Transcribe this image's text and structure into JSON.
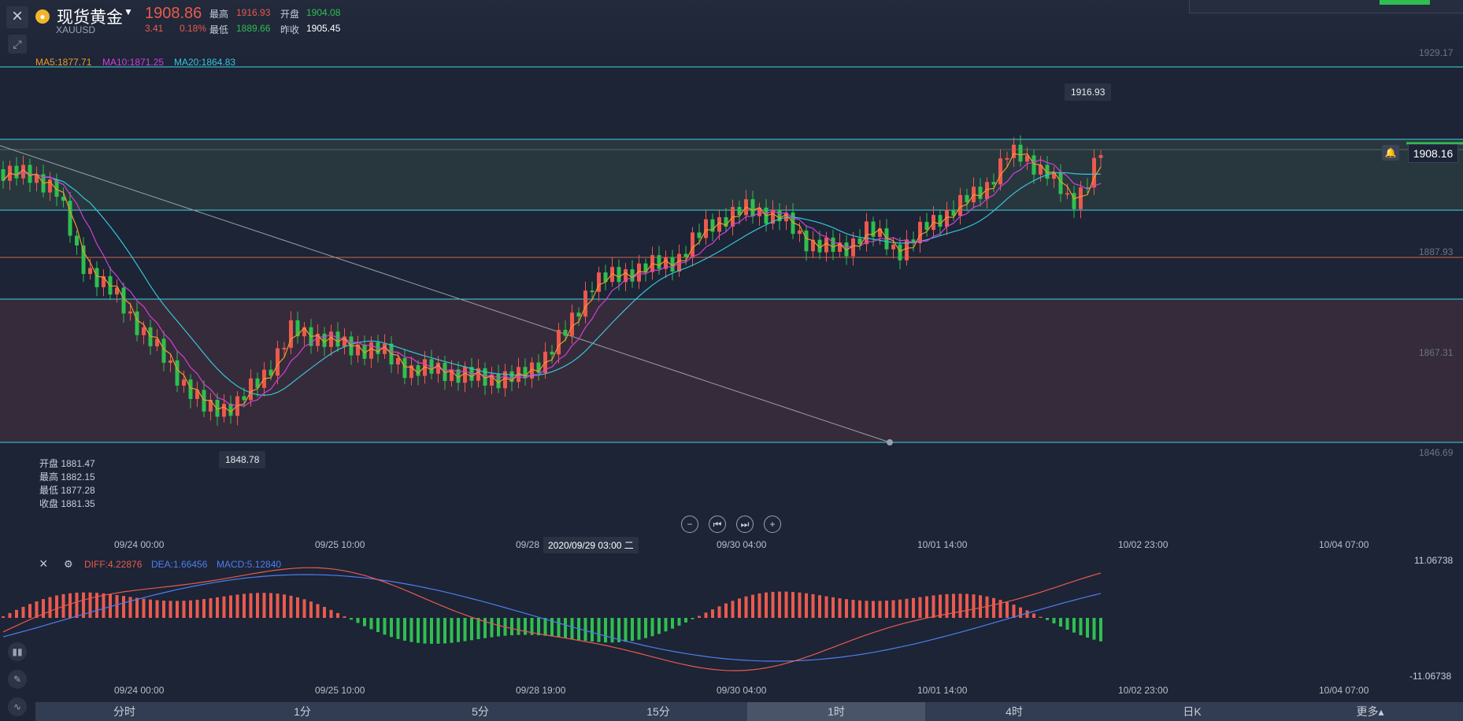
{
  "header": {
    "symbol_name": "现货黄金",
    "symbol_code": "XAUUSD",
    "price": "1908.86",
    "change": "3.41",
    "change_pct": "0.18%",
    "high_label": "最高",
    "high": "1916.93",
    "low_label": "最低",
    "low": "1889.66",
    "open_label": "开盘",
    "open": "1904.08",
    "prev_close_label": "昨收",
    "prev_close": "1905.45"
  },
  "ma": {
    "ma5": "MA5:1877.71",
    "ma10": "MA10:1871.25",
    "ma20": "MA20:1864.83"
  },
  "price_labels": {
    "max_tag": "1916.93",
    "min_tag": "1848.78",
    "current": "1908.16"
  },
  "right_axis": [
    "1929.17",
    "1887.93",
    "1867.31",
    "1846.69"
  ],
  "ohlc_panel": {
    "open": "开盘 1881.47",
    "high": "最高 1882.15",
    "low": "最低 1877.28",
    "close": "收盘 1881.35"
  },
  "dates": [
    "09/24 00:00",
    "09/25 10:00",
    "09/28",
    "09/30 04:00",
    "10/01 14:00",
    "10/02 23:00",
    "10/04 07:00"
  ],
  "dates_bottom": [
    "09/24 00:00",
    "09/25 10:00",
    "09/28 19:00",
    "09/30 04:00",
    "10/01 14:00",
    "10/02 23:00",
    "10/04 07:00"
  ],
  "tooltip_date": "2020/09/29 03:00 二",
  "macd": {
    "diff": "DIFF:4.22876",
    "dea": "DEA:1.66456",
    "macd": "MACD:5.12840",
    "axis_top": "11.06738",
    "axis_bottom": "-11.06738"
  },
  "tabs": [
    "分时",
    "1分",
    "5分",
    "15分",
    "1时",
    "4时",
    "日K",
    "更多▴"
  ],
  "active_tab": "1时",
  "colors": {
    "up": "#ea5a4d",
    "down": "#2fbf4f",
    "ma5": "#f09a2a",
    "ma10": "#d23fd8",
    "ma20": "#38c4d8",
    "diff": "#ea5a4d",
    "dea": "#4f7ef0",
    "hline": "#3fd3df"
  },
  "icons": [
    "close-icon",
    "pin-icon",
    "gold-coin-icon",
    "bell-icon",
    "zoom-out-icon",
    "prev-icon",
    "next-icon",
    "zoom-in-icon",
    "indicator-icon",
    "pencil-icon",
    "line-icon"
  ]
}
